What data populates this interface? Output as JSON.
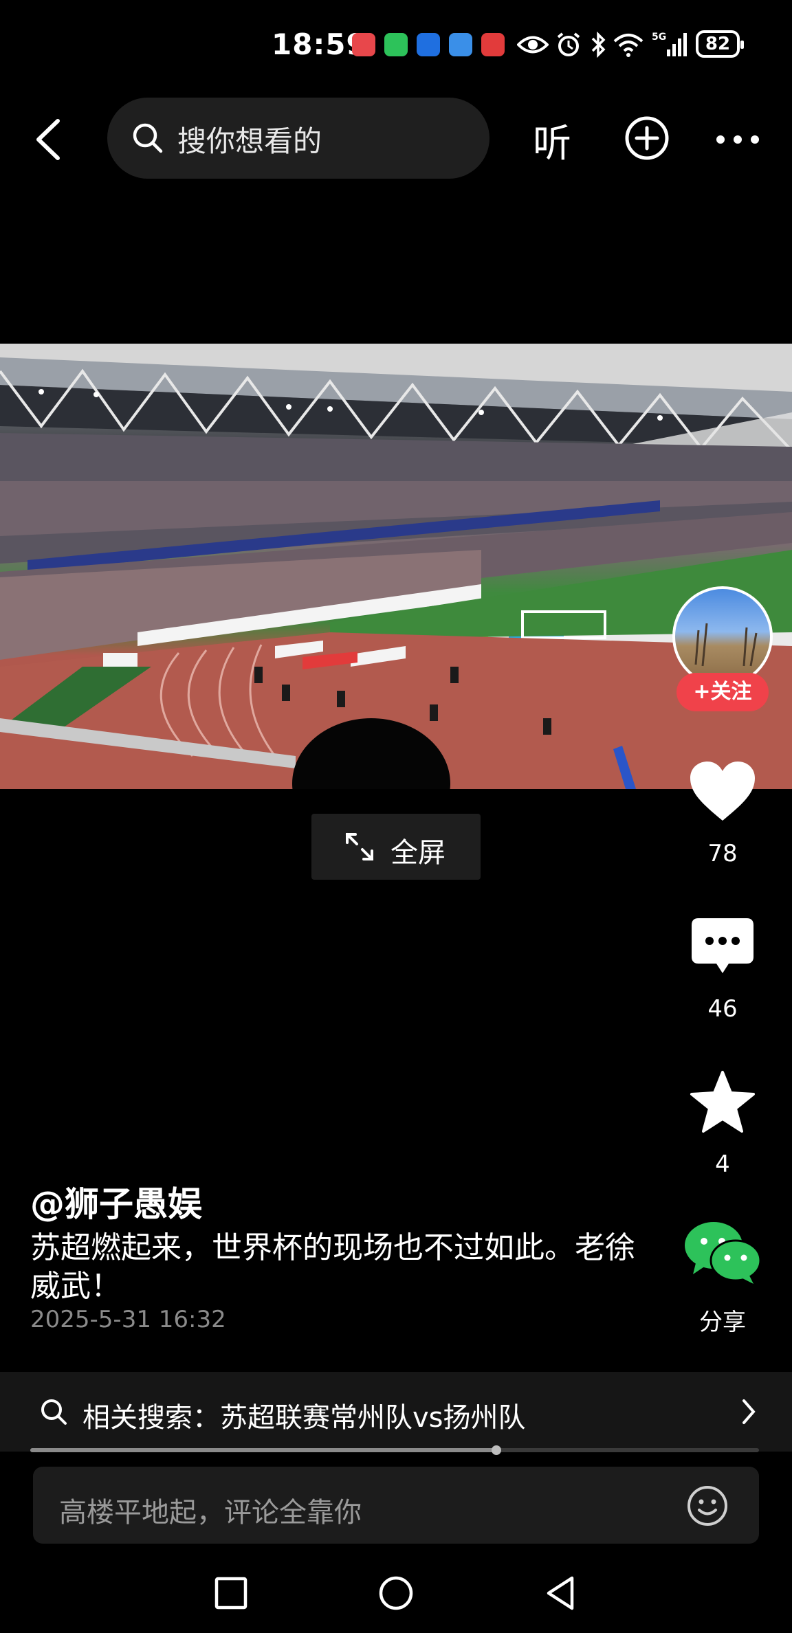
{
  "status_bar": {
    "time": "18:59",
    "battery": "82",
    "icons": [
      "notes-icon",
      "wechat-icon",
      "browser-icon",
      "app-icon",
      "huawei-icon",
      "eye-icon",
      "alarm-icon",
      "bluetooth-icon",
      "wifi-icon",
      "signal-icon"
    ]
  },
  "top_nav": {
    "search_placeholder": "搜你想看的",
    "listen_label": "听"
  },
  "video": {
    "fullscreen_label": "全屏"
  },
  "right_rail": {
    "follow_label": "+关注",
    "likes": "78",
    "comments": "46",
    "favorites": "4",
    "share_label": "分享"
  },
  "post": {
    "author": "@狮子愚娱",
    "text": "苏超燃起来，世界杯的现场也不过如此。老徐威武！",
    "date": "2025-5-31 16:32"
  },
  "related_search": {
    "text": "相关搜索：苏超联赛常州队vs扬州队"
  },
  "playback": {
    "progress": 0.64
  },
  "comment_box": {
    "placeholder": "高楼平地起，评论全靠你"
  },
  "colors": {
    "follow": "#f0424a",
    "wechat": "#2dc25a",
    "background": "#000000"
  }
}
